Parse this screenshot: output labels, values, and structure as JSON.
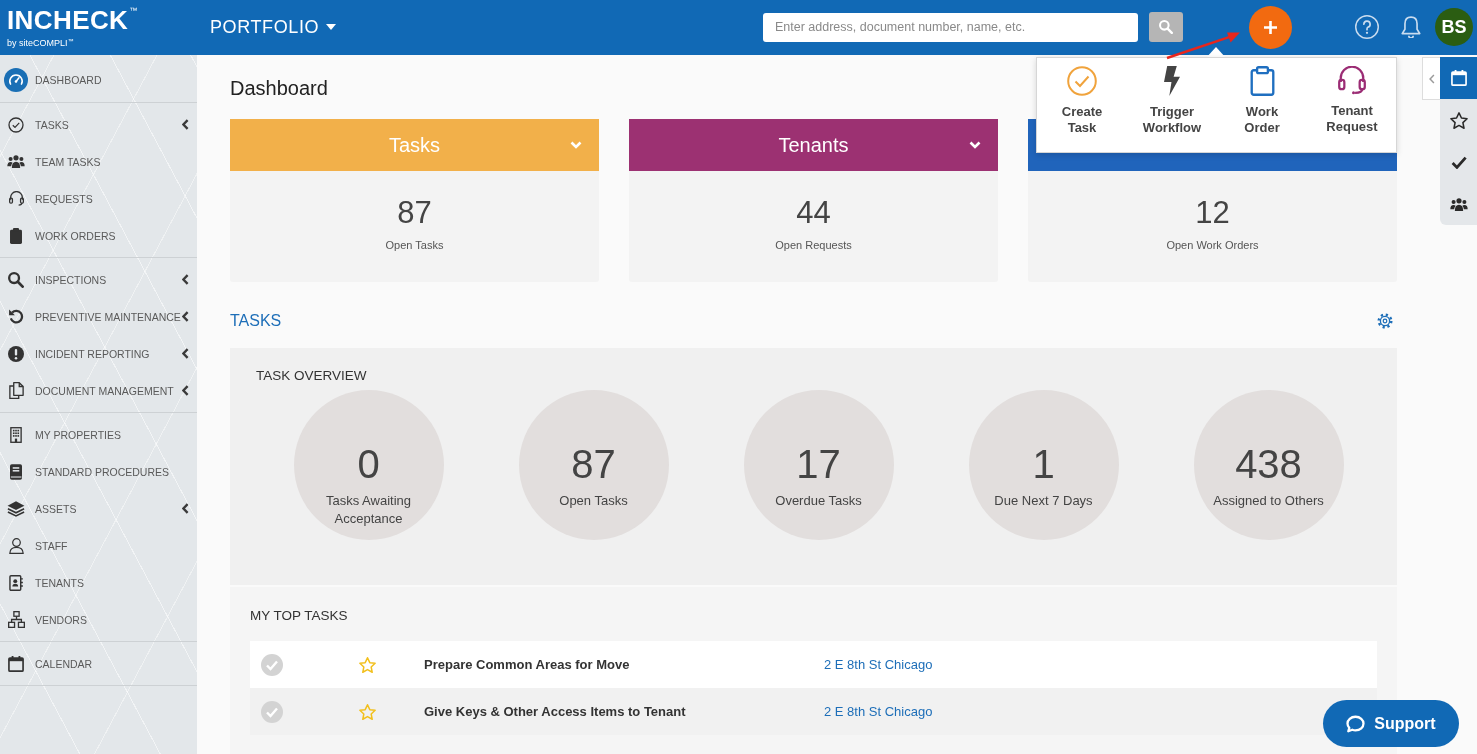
{
  "topbar": {
    "logo": {
      "name": "INCHECK",
      "mark": "™",
      "byline": "by siteCOMPLI",
      "byline_mark": "™"
    },
    "portfolio": "PORTFOLIO",
    "search": {
      "placeholder": "Enter address, document number, name, etc."
    },
    "avatar": "BS"
  },
  "quick_add": {
    "items": [
      {
        "label": "Create Task",
        "color": "#f0a33c"
      },
      {
        "label": "Trigger Workflow",
        "color": "#444444"
      },
      {
        "label": "Work Order",
        "color": "#1f6fc0"
      },
      {
        "label": "Tenant Request",
        "color": "#9b2c74"
      }
    ]
  },
  "sidebar": {
    "groups": [
      {
        "items": [
          {
            "label": "DASHBOARD",
            "selected": true,
            "expandable": false
          }
        ]
      },
      {
        "items": [
          {
            "label": "TASKS",
            "selected": false,
            "expandable": true
          },
          {
            "label": "TEAM TASKS",
            "selected": false,
            "expandable": false
          },
          {
            "label": "REQUESTS",
            "selected": false,
            "expandable": false
          },
          {
            "label": "WORK ORDERS",
            "selected": false,
            "expandable": false
          }
        ]
      },
      {
        "items": [
          {
            "label": "INSPECTIONS",
            "selected": false,
            "expandable": true
          },
          {
            "label": "PREVENTIVE MAINTENANCE",
            "selected": false,
            "expandable": true
          },
          {
            "label": "INCIDENT REPORTING",
            "selected": false,
            "expandable": true
          },
          {
            "label": "DOCUMENT MANAGEMENT",
            "selected": false,
            "expandable": true
          }
        ]
      },
      {
        "items": [
          {
            "label": "MY PROPERTIES",
            "selected": false,
            "expandable": false
          },
          {
            "label": "STANDARD PROCEDURES",
            "selected": false,
            "expandable": false
          },
          {
            "label": "ASSETS",
            "selected": false,
            "expandable": true
          },
          {
            "label": "STAFF",
            "selected": false,
            "expandable": false
          },
          {
            "label": "TENANTS",
            "selected": false,
            "expandable": false
          },
          {
            "label": "VENDORS",
            "selected": false,
            "expandable": false
          }
        ]
      },
      {
        "items": [
          {
            "label": "CALENDAR",
            "selected": false,
            "expandable": false
          }
        ]
      }
    ]
  },
  "page": {
    "title": "Dashboard"
  },
  "cards": [
    {
      "title": "Tasks",
      "color": "#f2b04a",
      "count": "87",
      "label": "Open Tasks"
    },
    {
      "title": "Tenants",
      "color": "#9c3172",
      "count": "44",
      "label": "Open Requests"
    },
    {
      "color": "#2064bb",
      "count": "12",
      "label": "Open Work Orders"
    }
  ],
  "tasks_section": {
    "title": "TASKS",
    "overview": {
      "title": "TASK OVERVIEW",
      "stats": [
        {
          "value": "0",
          "label": "Tasks Awaiting Acceptance"
        },
        {
          "value": "87",
          "label": "Open Tasks"
        },
        {
          "value": "17",
          "label": "Overdue Tasks"
        },
        {
          "value": "1",
          "label": "Due Next 7 Days"
        },
        {
          "value": "438",
          "label": "Assigned to Others"
        }
      ]
    },
    "top_tasks": {
      "title": "MY TOP TASKS",
      "rows": [
        {
          "title": "Prepare Common Areas for Move",
          "location": "2 E 8th St Chicago"
        },
        {
          "title": "Give Keys & Other Access Items to Tenant",
          "location": "2 E 8th St Chicago"
        }
      ]
    }
  },
  "side_tabs": [
    {
      "selected": true
    },
    {
      "selected": false
    },
    {
      "selected": false
    },
    {
      "selected": false
    }
  ],
  "support_button": "Support"
}
